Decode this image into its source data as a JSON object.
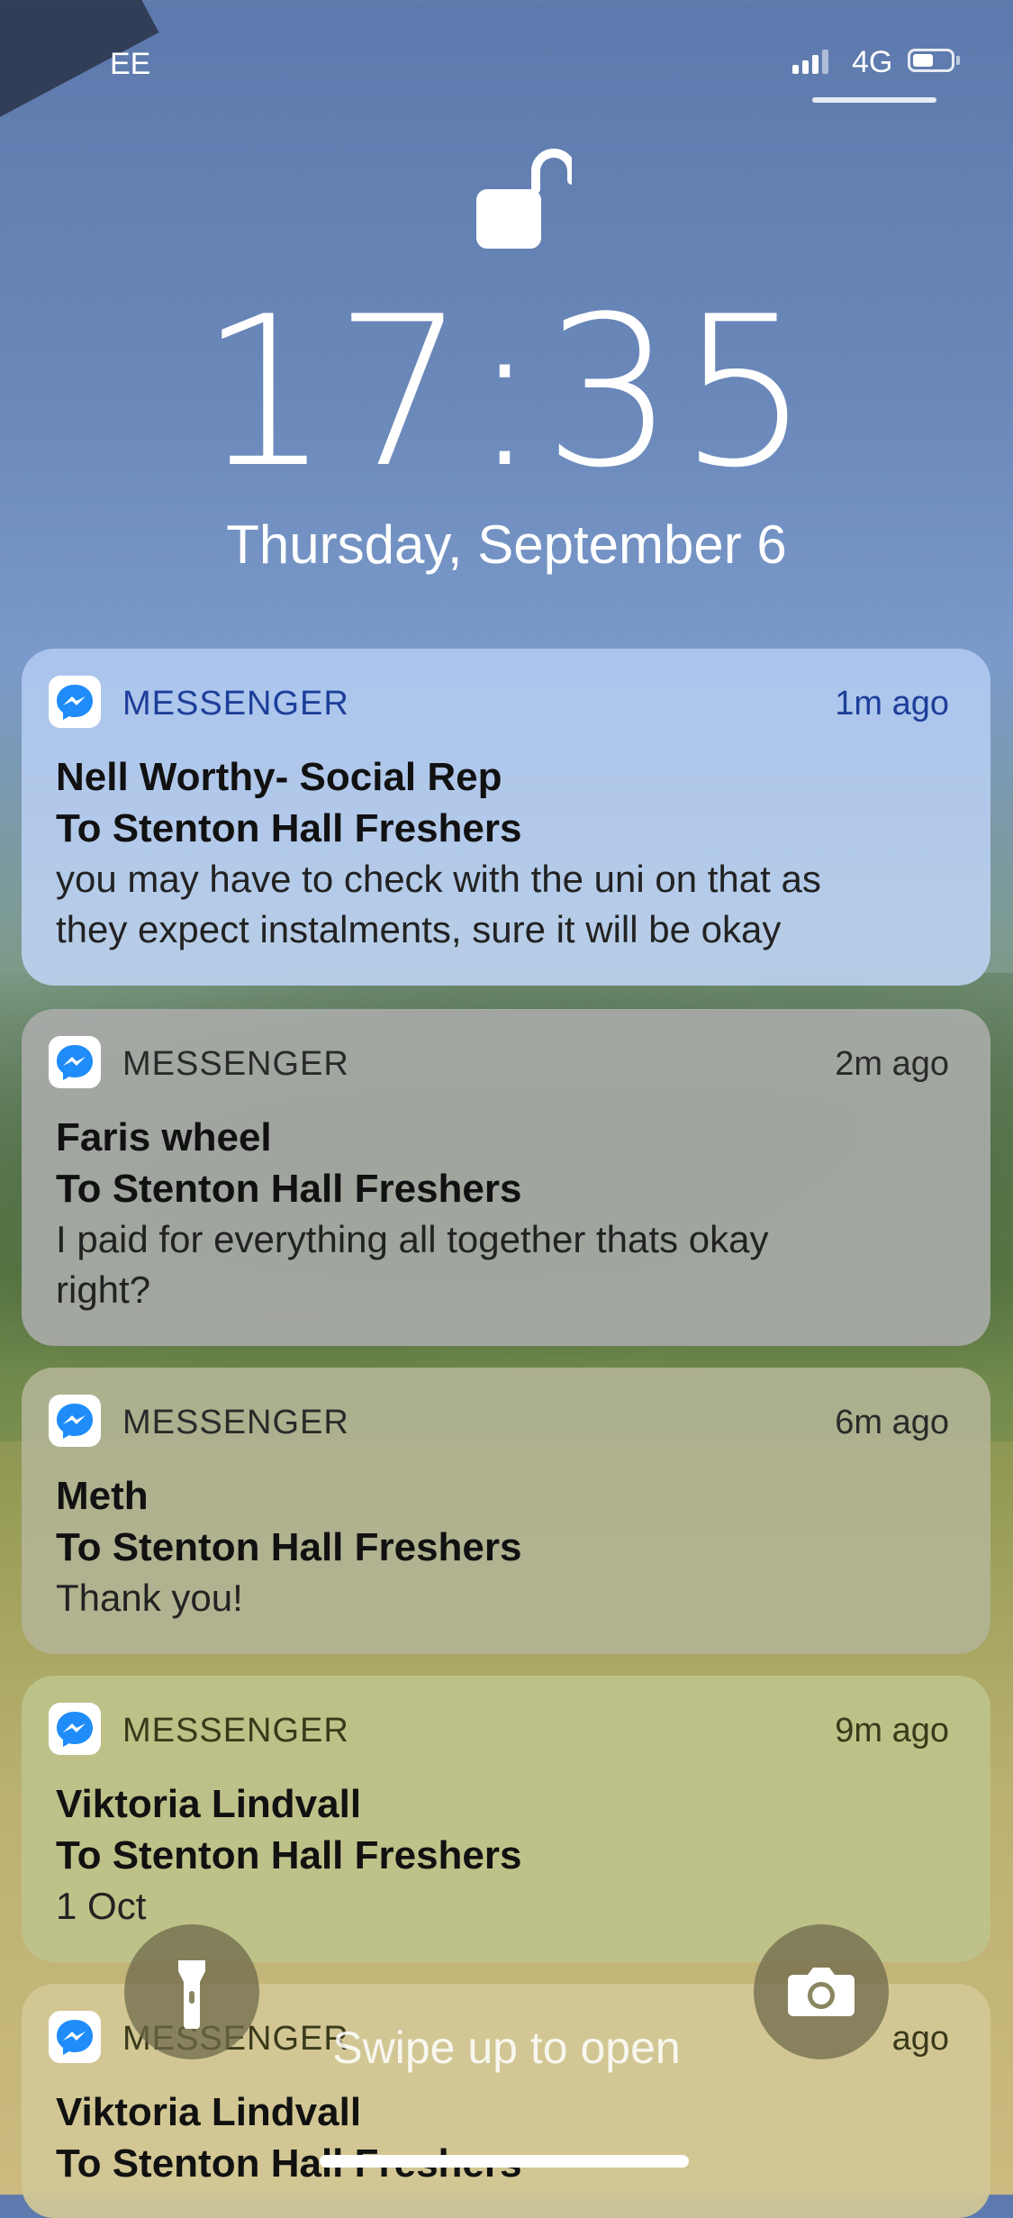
{
  "status_bar": {
    "carrier": "EE",
    "network": "4G",
    "signal_bars": 3,
    "battery_level": 0.45
  },
  "lockscreen": {
    "time": "17:35",
    "date": "Thursday, September 6",
    "lock_icon": "unlocked-padlock-icon"
  },
  "notifications": [
    {
      "app": "MESSENGER",
      "when": "1m ago",
      "title": "Nell Worthy- Social Rep",
      "subtitle": "To Stenton Hall Freshers",
      "body_lines": [
        "you may have to check with the uni on that as",
        "they expect instalments, sure it will be okay"
      ]
    },
    {
      "app": "MESSENGER",
      "when": "2m ago",
      "title": "Faris wheel",
      "subtitle": "To Stenton Hall Freshers",
      "body_lines": [
        "I paid for everything all together thats okay",
        "right?"
      ]
    },
    {
      "app": "MESSENGER",
      "when": "6m ago",
      "title": "Meth",
      "subtitle": "To Stenton Hall Freshers",
      "body_lines": [
        "Thank you!"
      ]
    },
    {
      "app": "MESSENGER",
      "when": "9m ago",
      "title": "Viktoria Lindvall",
      "subtitle": "To Stenton Hall Freshers",
      "body_lines": [
        "1 Oct"
      ]
    },
    {
      "app": "MESSENGER",
      "when": "ago",
      "title": "Viktoria Lindvall",
      "subtitle": "To Stenton Hall Freshers",
      "body_lines": []
    }
  ],
  "bottom": {
    "swipe_hint": "Swipe up to open",
    "flashlight_icon": "flashlight-icon",
    "camera_icon": "camera-icon"
  },
  "colors": {
    "messenger_blue": "#1f8cf9",
    "notif_first_text": "#1d3f9a"
  }
}
